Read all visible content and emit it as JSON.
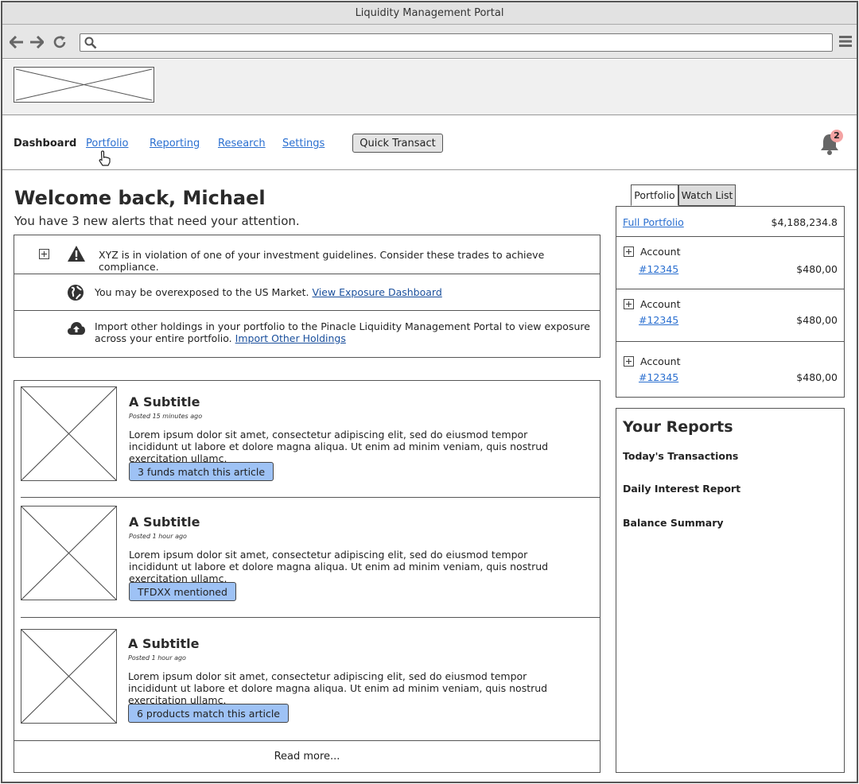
{
  "window": {
    "title": "Liquidity Management Portal"
  },
  "browser": {
    "url_value": "",
    "icons": [
      "back-arrow-icon",
      "forward-arrow-icon",
      "reload-icon",
      "search-icon",
      "hamburger-menu-icon"
    ]
  },
  "nav": {
    "items": [
      {
        "label": "Dashboard",
        "active": true
      },
      {
        "label": "Portfolio",
        "active": false
      },
      {
        "label": "Reporting",
        "active": false
      },
      {
        "label": "Research",
        "active": false
      },
      {
        "label": "Settings",
        "active": false
      }
    ],
    "quick_transact": "Quick Transact",
    "notification_count": "2"
  },
  "welcome": {
    "title": "Welcome back, Michael",
    "subtitle": "You have 3 new alerts that need your attention."
  },
  "alerts": [
    {
      "icon": "warning-icon",
      "text": "XYZ is in violation of one of your investment guidelines. Consider these trades to achieve compliance.",
      "link": ""
    },
    {
      "icon": "globe-icon",
      "text": "You may be overexposed to the US Market.",
      "link": "View Exposure Dashboard"
    },
    {
      "icon": "cloud-upload-icon",
      "text": "Import other holdings in your portfolio to the Pinacle Liquidity Management Portal to view exposure across your entire portfolio.",
      "link": "Import Other Holdings"
    }
  ],
  "articles": [
    {
      "title": "A Subtitle",
      "posted": "Posted 15 minutes ago",
      "body": "Lorem ipsum dolor sit amet, consectetur adipiscing elit, sed do eiusmod tempor incididunt ut labore et dolore magna aliqua. Ut enim ad minim veniam, quis nostrud exercitation ullamc.",
      "tag": "3 funds match this article"
    },
    {
      "title": "A Subtitle",
      "posted": "Posted 1 hour ago",
      "body": "Lorem ipsum dolor sit amet, consectetur adipiscing elit, sed do eiusmod tempor incididunt ut labore et dolore magna aliqua. Ut enim ad minim veniam, quis nostrud exercitation ullamc.",
      "tag": "TFDXX mentioned"
    },
    {
      "title": "A Subtitle",
      "posted": "Posted 1 hour ago",
      "body": "Lorem ipsum dolor sit amet, consectetur adipiscing elit, sed do eiusmod tempor incididunt ut labore et dolore magna aliqua. Ut enim ad minim veniam, quis nostrud exercitation ullamc.",
      "tag": "6 products match this article"
    }
  ],
  "read_more": "Read more...",
  "side_tabs": [
    {
      "label": "Portfolio",
      "active": true
    },
    {
      "label": "Watch List",
      "active": false
    }
  ],
  "portfolio": {
    "full_label": "Full Portfolio",
    "full_amount": "$4,188,234.8",
    "accounts": [
      {
        "label": "Account",
        "number": "#12345",
        "amount": "$480,00"
      },
      {
        "label": "Account",
        "number": "#12345",
        "amount": "$480,00"
      },
      {
        "label": "Account",
        "number": "#12345",
        "amount": "$480,00"
      }
    ]
  },
  "reports": {
    "title": "Your Reports",
    "items": [
      "Today's Transactions",
      "Daily Interest Report",
      "Balance Summary"
    ]
  },
  "colors": {
    "link": "#2a6fd0",
    "tag_bg": "#9ec2f5",
    "badge_bg": "#f4a3a3"
  }
}
